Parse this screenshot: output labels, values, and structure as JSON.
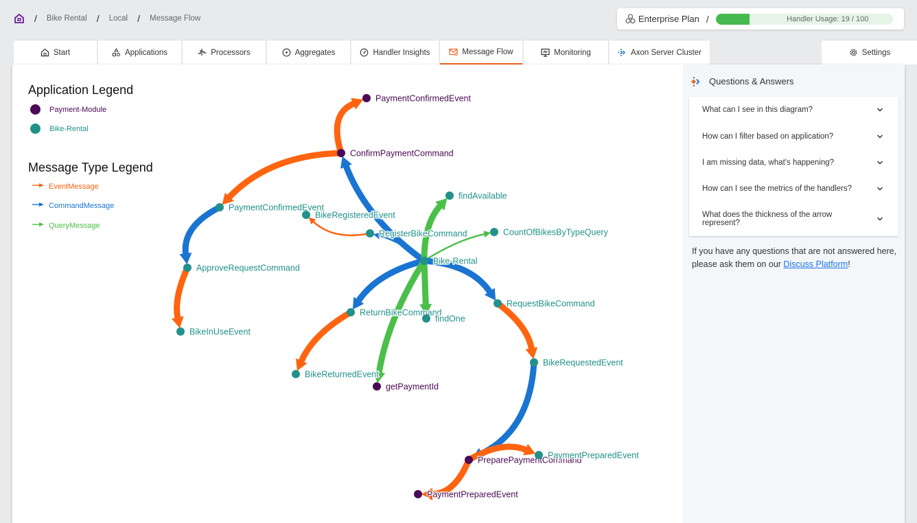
{
  "breadcrumb": {
    "home_icon": "home-icon",
    "items": [
      "Bike Rental",
      "Local",
      "Message Flow"
    ]
  },
  "plan": {
    "icon": "cluster-icon",
    "label": "Enterprise Plan",
    "usage_label": "Handler Usage: 19 / 100",
    "usage_value": 19,
    "usage_max": 100
  },
  "tabs": [
    {
      "label": "Start",
      "icon": "home-icon",
      "active": false
    },
    {
      "label": "Applications",
      "icon": "shapes-icon",
      "active": false
    },
    {
      "label": "Processors",
      "icon": "pulse-icon",
      "active": false
    },
    {
      "label": "Aggregates",
      "icon": "target-icon",
      "active": false
    },
    {
      "label": "Handler Insights",
      "icon": "gauge-icon",
      "active": false
    },
    {
      "label": "Message Flow",
      "icon": "mail-icon",
      "active": true
    },
    {
      "label": "Monitoring",
      "icon": "monitor-icon",
      "active": false
    },
    {
      "label": "Axon Server Cluster",
      "icon": "axon-icon",
      "active": false
    }
  ],
  "settings_tab": {
    "label": "Settings",
    "icon": "gear-icon"
  },
  "colors": {
    "event": "#ff6410",
    "command": "#1a74d2",
    "query": "#4cbf4a",
    "payment_module": "#4a0a55",
    "bike_rental": "#22918a",
    "accent": "#f26522",
    "link": "#1a73e8"
  },
  "legend": {
    "application_title": "Application Legend",
    "applications": [
      {
        "label": "Payment-Module",
        "color": "#4a0a55"
      },
      {
        "label": "Bike-Rental",
        "color": "#22918a"
      }
    ],
    "message_type_title": "Message Type Legend",
    "message_types": [
      {
        "label": "EventMessage",
        "color": "#ff6410"
      },
      {
        "label": "CommandMessage",
        "color": "#1a74d2"
      },
      {
        "label": "QueryMessage",
        "color": "#4cbf4a"
      }
    ]
  },
  "graph": {
    "nodes": [
      {
        "id": "pm_PaymentConfirmedEvent",
        "label": "PaymentConfirmedEvent",
        "app": "Payment-Module"
      },
      {
        "id": "ConfirmPaymentCommand",
        "label": "ConfirmPaymentCommand",
        "app": "Payment-Module"
      },
      {
        "id": "br_PaymentConfirmedEvent",
        "label": "PaymentConfirmedEvent",
        "app": "Bike-Rental"
      },
      {
        "id": "BikeRegisteredEvent",
        "label": "BikeRegisteredEvent",
        "app": "Bike-Rental"
      },
      {
        "id": "findAvailable",
        "label": "findAvailable",
        "app": "Bike-Rental"
      },
      {
        "id": "RegisterBikeCommand",
        "label": "RegisterBikeCommand",
        "app": "Bike-Rental"
      },
      {
        "id": "CountOfBikesByTypeQuery",
        "label": "CountOfBikesByTypeQuery",
        "app": "Bike-Rental"
      },
      {
        "id": "BikeRental",
        "label": "Bike-Rental",
        "app": "Bike-Rental"
      },
      {
        "id": "ApproveRequestCommand",
        "label": "ApproveRequestCommand",
        "app": "Bike-Rental"
      },
      {
        "id": "RequestBikeCommand",
        "label": "RequestBikeCommand",
        "app": "Bike-Rental"
      },
      {
        "id": "ReturnBikeCommand",
        "label": "ReturnBikeCommand",
        "app": "Bike-Rental"
      },
      {
        "id": "findOne",
        "label": "findOne",
        "app": "Bike-Rental"
      },
      {
        "id": "BikeInUseEvent",
        "label": "BikeInUseEvent",
        "app": "Bike-Rental"
      },
      {
        "id": "BikeRequestedEvent",
        "label": "BikeRequestedEvent",
        "app": "Bike-Rental"
      },
      {
        "id": "BikeReturnedEvent",
        "label": "BikeReturnedEvent",
        "app": "Bike-Rental"
      },
      {
        "id": "getPaymentId",
        "label": "getPaymentId",
        "app": "Payment-Module"
      },
      {
        "id": "PreparePaymentCommand",
        "label": "PreparePaymentCommand",
        "app": "Payment-Module"
      },
      {
        "id": "br_PaymentPreparedEvent",
        "label": "PaymentPreparedEvent",
        "app": "Bike-Rental"
      },
      {
        "id": "pm_PaymentPreparedEvent",
        "label": "PaymentPreparedEvent",
        "app": "Payment-Module"
      }
    ],
    "edges": [
      {
        "from": "ConfirmPaymentCommand",
        "to": "pm_PaymentConfirmedEvent",
        "type": "event",
        "weight": 3
      },
      {
        "from": "ConfirmPaymentCommand",
        "to": "br_PaymentConfirmedEvent",
        "type": "event",
        "weight": 3
      },
      {
        "from": "BikeRental",
        "to": "ConfirmPaymentCommand",
        "type": "command",
        "weight": 3
      },
      {
        "from": "br_PaymentConfirmedEvent",
        "to": "ApproveRequestCommand",
        "type": "command",
        "weight": 3
      },
      {
        "from": "ApproveRequestCommand",
        "to": "BikeInUseEvent",
        "type": "event",
        "weight": 3
      },
      {
        "from": "RegisterBikeCommand",
        "to": "BikeRegisteredEvent",
        "type": "event",
        "weight": 1
      },
      {
        "from": "BikeRental",
        "to": "RegisterBikeCommand",
        "type": "command",
        "weight": 1
      },
      {
        "from": "BikeRental",
        "to": "findAvailable",
        "type": "query",
        "weight": 3
      },
      {
        "from": "BikeRental",
        "to": "CountOfBikesByTypeQuery",
        "type": "query",
        "weight": 1
      },
      {
        "from": "BikeRental",
        "to": "RequestBikeCommand",
        "type": "command",
        "weight": 3
      },
      {
        "from": "RequestBikeCommand",
        "to": "BikeRequestedEvent",
        "type": "event",
        "weight": 3
      },
      {
        "from": "BikeRental",
        "to": "ReturnBikeCommand",
        "type": "command",
        "weight": 3
      },
      {
        "from": "ReturnBikeCommand",
        "to": "BikeReturnedEvent",
        "type": "event",
        "weight": 3
      },
      {
        "from": "BikeRental",
        "to": "findOne",
        "type": "query",
        "weight": 3
      },
      {
        "from": "BikeRental",
        "to": "getPaymentId",
        "type": "query",
        "weight": 3
      },
      {
        "from": "BikeRequestedEvent",
        "to": "PreparePaymentCommand",
        "type": "command",
        "weight": 3
      },
      {
        "from": "PreparePaymentCommand",
        "to": "br_PaymentPreparedEvent",
        "type": "event",
        "weight": 3
      },
      {
        "from": "PreparePaymentCommand",
        "to": "pm_PaymentPreparedEvent",
        "type": "event",
        "weight": 3
      }
    ]
  },
  "qa": {
    "title": "Questions & Answers",
    "icon": "axon-qa-icon",
    "questions": [
      "What can I see in this diagram?",
      "How can I filter based on application?",
      "I am missing data, what's happening?",
      "How can I see the metrics of the handlers?",
      "What does the thickness of the arrow represent?"
    ],
    "footer_text": "If you have any questions that are not answered here, please ask them on our ",
    "footer_link": "Discuss Platform",
    "footer_end": "!"
  }
}
